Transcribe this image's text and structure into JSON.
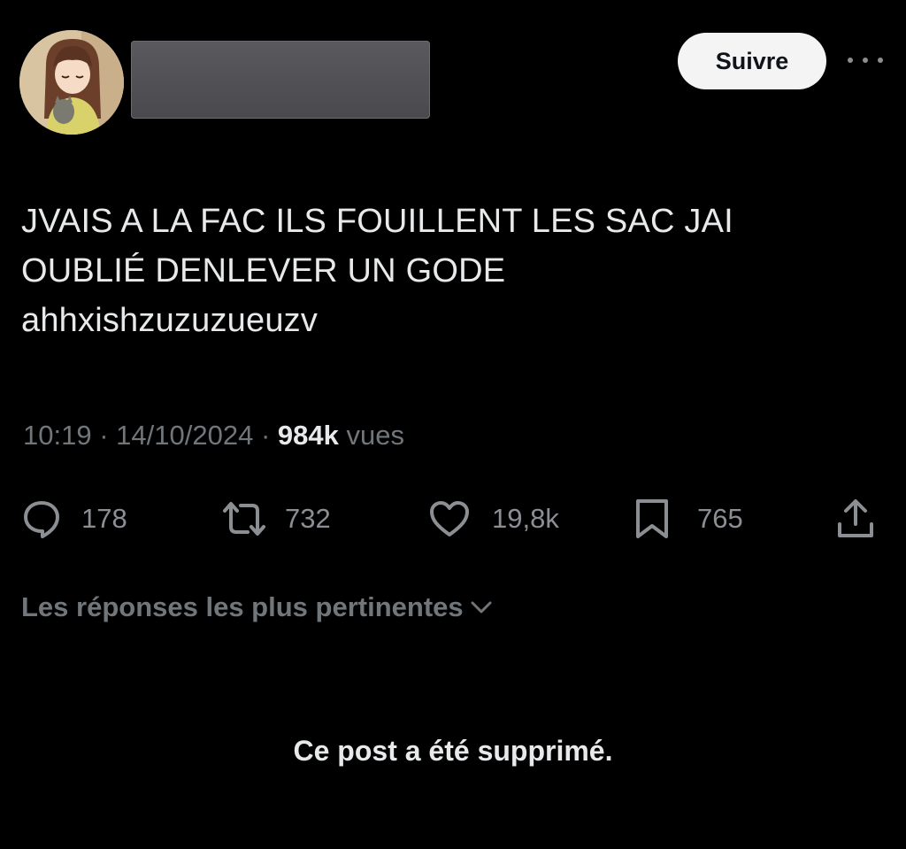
{
  "header": {
    "avatar_icon": "avatar-anime-girl",
    "follow_label": "Suivre",
    "more_icon": "more-horizontal-icon"
  },
  "tweet": {
    "lines": [
      "JVAIS A LA FAC ILS FOUILLENT LES SAC JAI",
      "OUBLIÉ DENLEVER UN GODE",
      "ahhxishzuzuzueuzv"
    ],
    "time": "10:19",
    "separator": "·",
    "date": "14/10/2024",
    "views_count": "984k",
    "views_label": "vues"
  },
  "actions": {
    "replies": {
      "icon": "reply-icon",
      "count": "178"
    },
    "reposts": {
      "icon": "repost-icon",
      "count": "732"
    },
    "likes": {
      "icon": "heart-icon",
      "count": "19,8k"
    },
    "bookmarks": {
      "icon": "bookmark-icon",
      "count": "765"
    },
    "share": {
      "icon": "share-icon"
    }
  },
  "replies_section": {
    "sort_label": "Les réponses les plus pertinentes",
    "sort_icon": "chevron-down-icon",
    "deleted_notice": "Ce post a été supprimé."
  },
  "colors": {
    "background": "#000000",
    "primary_text": "#e7e9ea",
    "secondary_text": "#71767b",
    "icon_gray": "#8b8f94",
    "follow_button_bg": "#f4f4f4"
  }
}
